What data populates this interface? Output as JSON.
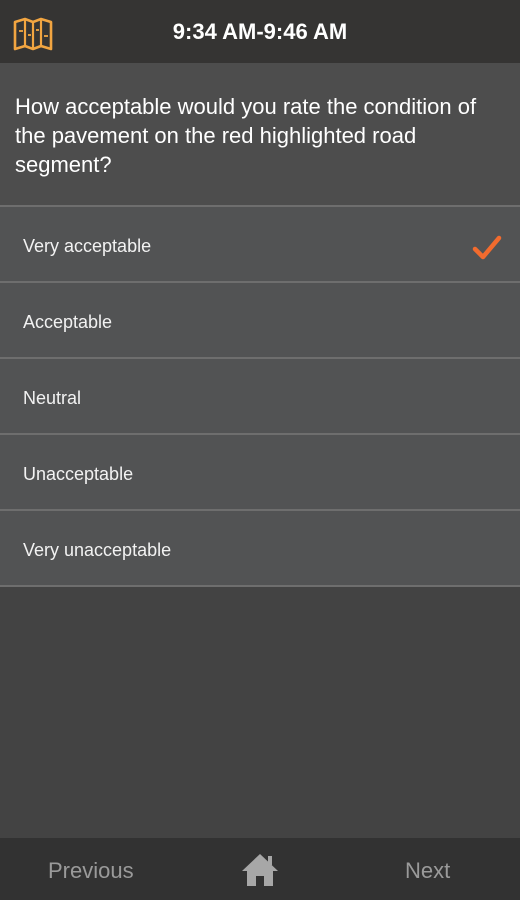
{
  "header": {
    "time_range": "9:34 AM-9:46 AM",
    "map_icon": "map-icon"
  },
  "question": {
    "text": "How acceptable would you rate the condition of the pavement on the red highlighted road segment?"
  },
  "options": [
    {
      "label": "Very acceptable",
      "selected": true
    },
    {
      "label": "Acceptable",
      "selected": false
    },
    {
      "label": "Neutral",
      "selected": false
    },
    {
      "label": "Unacceptable",
      "selected": false
    },
    {
      "label": "Very unacceptable",
      "selected": false
    }
  ],
  "footer": {
    "previous_label": "Previous",
    "next_label": "Next",
    "home_icon": "home-icon"
  },
  "colors": {
    "accent": "#f26b2e",
    "map_icon": "#f2a541",
    "background": "#434343",
    "option_bg": "#525354",
    "bar_bg": "#323232"
  }
}
